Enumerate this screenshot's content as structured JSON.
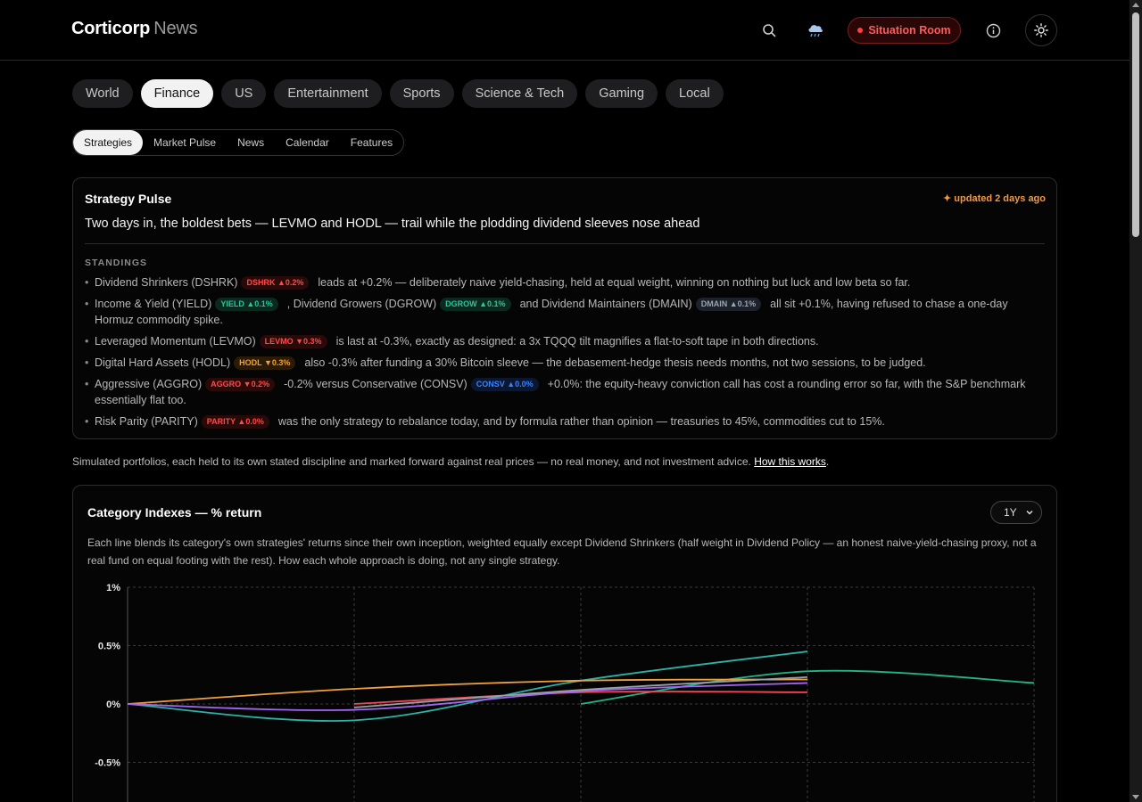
{
  "header": {
    "brand_primary": "Corticorp",
    "brand_secondary": "News",
    "situation_label": "Situation Room"
  },
  "categories": [
    {
      "label": "World",
      "active": false
    },
    {
      "label": "Finance",
      "active": true
    },
    {
      "label": "US",
      "active": false
    },
    {
      "label": "Entertainment",
      "active": false
    },
    {
      "label": "Sports",
      "active": false
    },
    {
      "label": "Science & Tech",
      "active": false
    },
    {
      "label": "Gaming",
      "active": false
    },
    {
      "label": "Local",
      "active": false
    }
  ],
  "subtabs": [
    {
      "label": "Strategies",
      "active": true
    },
    {
      "label": "Market Pulse",
      "active": false
    },
    {
      "label": "News",
      "active": false
    },
    {
      "label": "Calendar",
      "active": false
    },
    {
      "label": "Features",
      "active": false
    }
  ],
  "pulse": {
    "title": "Strategy Pulse",
    "updated": "✦ updated 2 days ago",
    "headline": "Two days in, the boldest bets — LEVMO and HODL — trail while the plodding dividend sleeves nose ahead",
    "standings_label": "STANDINGS",
    "standings": [
      {
        "parts": [
          {
            "text": "Dividend Shrinkers (DSHRK)"
          },
          {
            "ticker": "DSHRK ▲0.2%",
            "color": "red"
          },
          {
            "text": "leads at +0.2% — deliberately naive yield-chasing, held at equal weight, winning on nothing but luck and low beta so far."
          }
        ]
      },
      {
        "parts": [
          {
            "text": "Income & Yield (YIELD)"
          },
          {
            "ticker": "YIELD ▲0.1%",
            "color": "green"
          },
          {
            "text": ", Dividend Growers (DGROW)"
          },
          {
            "ticker": "DGROW ▲0.1%",
            "color": "green"
          },
          {
            "text": "and Dividend Maintainers (DMAIN)"
          },
          {
            "ticker": "DMAIN ▲0.1%",
            "color": "slate"
          },
          {
            "text": "all sit +0.1%, having refused to chase a one-day Hormuz commodity spike."
          }
        ]
      },
      {
        "parts": [
          {
            "text": "Leveraged Momentum (LEVMO)"
          },
          {
            "ticker": "LEVMO ▼0.3%",
            "color": "red"
          },
          {
            "text": "is last at -0.3%, exactly as designed: a 3x TQQQ tilt magnifies a flat-to-soft tape in both directions."
          }
        ]
      },
      {
        "parts": [
          {
            "text": "Digital Hard Assets (HODL)"
          },
          {
            "ticker": "HODL ▼0.3%",
            "color": "orange"
          },
          {
            "text": "also -0.3% after funding a 30% Bitcoin sleeve — the debasement-hedge thesis needs months, not two sessions, to be judged."
          }
        ]
      },
      {
        "parts": [
          {
            "text": "Aggressive (AGGRO)"
          },
          {
            "ticker": "AGGRO ▼0.2%",
            "color": "red"
          },
          {
            "text": "-0.2% versus Conservative (CONSV)"
          },
          {
            "ticker": "CONSV ▲0.0%",
            "color": "blue"
          },
          {
            "text": "+0.0%: the equity-heavy conviction call has cost a rounding error so far, with the S&P benchmark essentially flat too."
          }
        ]
      },
      {
        "parts": [
          {
            "text": "Risk Parity (PARITY)"
          },
          {
            "ticker": "PARITY ▲0.0%",
            "color": "red"
          },
          {
            "text": "was the only strategy to rebalance today, and by formula rather than opinion — treasuries to 45%, commodities cut to 15%."
          }
        ]
      }
    ]
  },
  "disclaimer": {
    "text": "Simulated portfolios, each held to its own stated discipline and marked forward against real prices — no real money, and not investment advice.",
    "link": "How this works",
    "suffix": "."
  },
  "chart_card": {
    "title": "Category Indexes — % return",
    "range": "1Y",
    "description": "Each line blends its category's own strategies' returns since their own inception, weighted equally except Dividend Shrinkers (half weight in Dividend Policy — an honest naive-yield-chasing proxy, not a real fund on equal footing with the rest). How each whole approach is doing, not any single strategy."
  },
  "chart_data": {
    "type": "line",
    "title": "Category Indexes — % return",
    "ylabel": "",
    "xlabel": "",
    "y_ticks": [
      "1%",
      "0.5%",
      "0%",
      "-0.5%"
    ],
    "ylim": [
      -0.85,
      1.0
    ],
    "x": [
      0,
      1,
      2,
      3,
      4
    ],
    "grid": true,
    "colors": {
      "teal": "#2bb3a8",
      "green": "#22b589",
      "orange": "#f0a23a",
      "red": "#f04a5a",
      "purple": "#a666f2",
      "gray": "#9aa0a8"
    },
    "series": [
      {
        "color": "teal",
        "x": [
          0,
          1,
          2,
          3
        ],
        "values": [
          0.0,
          -0.14,
          0.2,
          0.45
        ]
      },
      {
        "color": "green",
        "x": [
          2,
          3,
          4
        ],
        "values": [
          0.0,
          0.28,
          0.18
        ]
      },
      {
        "color": "orange",
        "x": [
          0,
          1,
          2,
          3
        ],
        "values": [
          0.0,
          0.13,
          0.2,
          0.21
        ]
      },
      {
        "color": "red",
        "x": [
          1,
          2,
          3
        ],
        "values": [
          0.0,
          0.1,
          0.1
        ]
      },
      {
        "color": "purple",
        "x": [
          0,
          1,
          2,
          3
        ],
        "values": [
          0.0,
          -0.05,
          0.11,
          0.18
        ]
      },
      {
        "color": "gray",
        "x": [
          1,
          2,
          3
        ],
        "values": [
          -0.03,
          0.12,
          0.23
        ]
      }
    ]
  }
}
